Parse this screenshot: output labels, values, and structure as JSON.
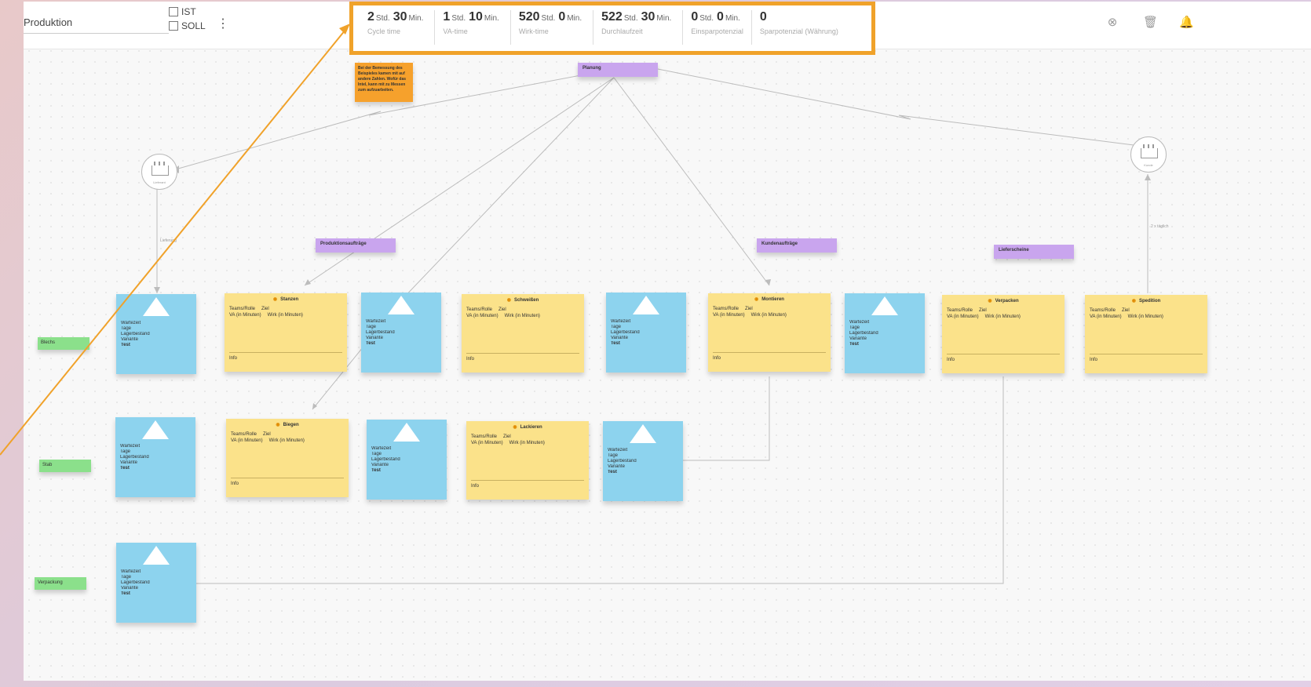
{
  "header": {
    "title": "Produktion",
    "checkbox_ist": "IST",
    "checkbox_soll": "SOLL"
  },
  "metrics": [
    {
      "h": "2",
      "hu": "Std.",
      "m": "30",
      "mu": "Min.",
      "label": "Cycle time"
    },
    {
      "h": "1",
      "hu": "Std.",
      "m": "10",
      "mu": "Min.",
      "label": "VA-time"
    },
    {
      "h": "520",
      "hu": "Std.",
      "m": "0",
      "mu": "Min.",
      "label": "Wirk-time"
    },
    {
      "h": "522",
      "hu": "Std.",
      "m": "30",
      "mu": "Min.",
      "label": "Durchlaufzeit"
    },
    {
      "h": "0",
      "hu": "Std.",
      "m": "0",
      "mu": "Min.",
      "label": "Einsparpotenzial"
    },
    {
      "h": "0",
      "hu": "",
      "m": "",
      "mu": "",
      "label": "Sparpotenzial (Währung)"
    }
  ],
  "canvas": {
    "planung": "Planung",
    "orange_note": "Bei der Bemessung des Beispieles kamen mit auf andere Zahlen. Wofür das Intel, kann mit zu Messen zum aufzuarbeiten.",
    "produktionsauftraege": "Produktionsaufträge",
    "kundenauftraege": "Kundenaufträge",
    "lieferscheine": "Lieferscheine",
    "lanes": [
      "Blechs",
      "Stab",
      "Verpackung"
    ],
    "process_steps": [
      "Stanzen",
      "Biegen",
      "Schweißen",
      "Lackieren",
      "Montieren",
      "Verpacken",
      "Spedition"
    ],
    "blue_lines": [
      "Wartezeit",
      "Tage",
      "Lagerbestand",
      "Variante",
      "Test"
    ],
    "yellow_lines": [
      "Teams/Rolle",
      "Ziel",
      "VA (in Minuten)",
      "Wirk (in Minuten)",
      "Info"
    ],
    "tiny_labels": [
      "Lieferung",
      "2 x täglich"
    ]
  }
}
